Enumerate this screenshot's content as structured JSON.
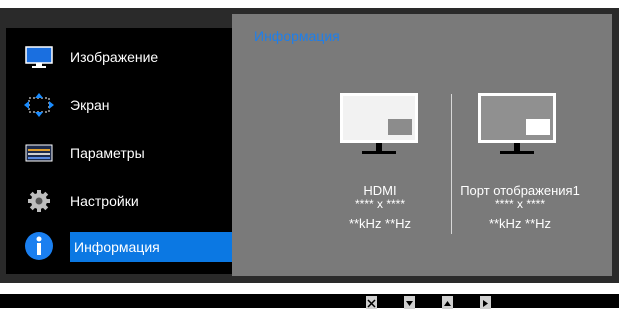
{
  "menu": {
    "items": [
      {
        "label": "Изображение",
        "icon": "monitor-icon"
      },
      {
        "label": "Экран",
        "icon": "resize-arrows-icon"
      },
      {
        "label": "Параметры",
        "icon": "sliders-icon"
      },
      {
        "label": "Настройки",
        "icon": "gear-icon"
      },
      {
        "label": "Информация",
        "icon": "info-icon",
        "active": true
      }
    ]
  },
  "panel": {
    "title": "Информация",
    "ports": [
      {
        "name": "HDMI",
        "resolution": "**** x ****",
        "frequency": "**kHz **Hz"
      },
      {
        "name": "Порт отображения1",
        "resolution": "**** x ****",
        "frequency": "**kHz **Hz"
      }
    ]
  },
  "colors": {
    "accent": "#0b78e3",
    "title": "#1f7fe9",
    "panel_bg": "#7a7a7a",
    "menu_bg": "#000000"
  },
  "bottom_keys": [
    "close-key-icon",
    "down-key-icon",
    "up-key-icon",
    "right-key-icon"
  ]
}
